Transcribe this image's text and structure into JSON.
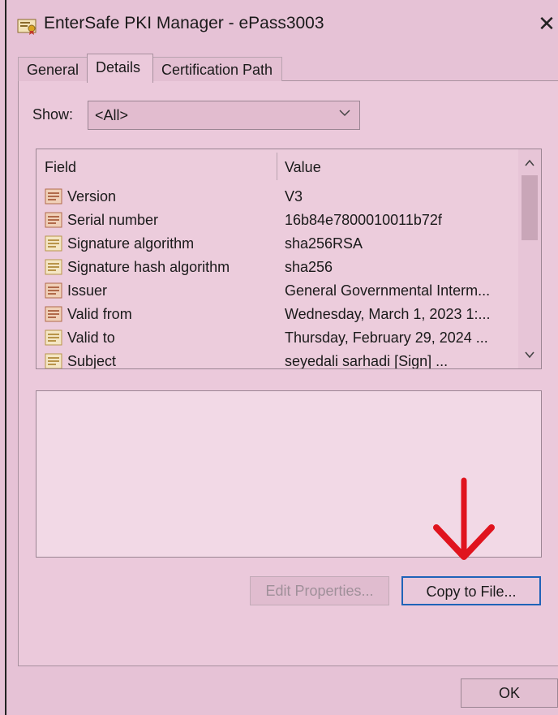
{
  "window": {
    "title": "EnterSafe PKI Manager - ePass3003",
    "close_glyph": "✕"
  },
  "tabs": [
    {
      "label": "General",
      "active": false
    },
    {
      "label": "Details",
      "active": true
    },
    {
      "label": "Certification Path",
      "active": false
    }
  ],
  "show": {
    "label": "Show:",
    "selected": "<All>"
  },
  "list": {
    "headers": {
      "field": "Field",
      "value": "Value"
    },
    "rows": [
      {
        "field": "Version",
        "value": "V3",
        "icon": "certificate-field-icon"
      },
      {
        "field": "Serial number",
        "value": "16b84e7800010011b72f",
        "icon": "certificate-field-icon"
      },
      {
        "field": "Signature algorithm",
        "value": "sha256RSA",
        "icon": "certificate-field-icon"
      },
      {
        "field": "Signature hash algorithm",
        "value": "sha256",
        "icon": "certificate-field-icon"
      },
      {
        "field": "Issuer",
        "value": "General Governmental Interm...",
        "icon": "certificate-field-icon"
      },
      {
        "field": "Valid from",
        "value": "Wednesday, March 1, 2023 1:...",
        "icon": "certificate-field-icon"
      },
      {
        "field": "Valid to",
        "value": "Thursday, February 29, 2024 ...",
        "icon": "certificate-field-icon"
      },
      {
        "field": "Subject",
        "value": "seyedali sarhadi [Sign] ...",
        "icon": "certificate-field-icon"
      }
    ]
  },
  "buttons": {
    "edit_properties": "Edit Properties...",
    "copy_to_file": "Copy to File...",
    "ok": "OK"
  },
  "colors": {
    "background": "#e6c2d6",
    "focus_border": "#1f63b8",
    "annotation_arrow": "#e0141e"
  }
}
